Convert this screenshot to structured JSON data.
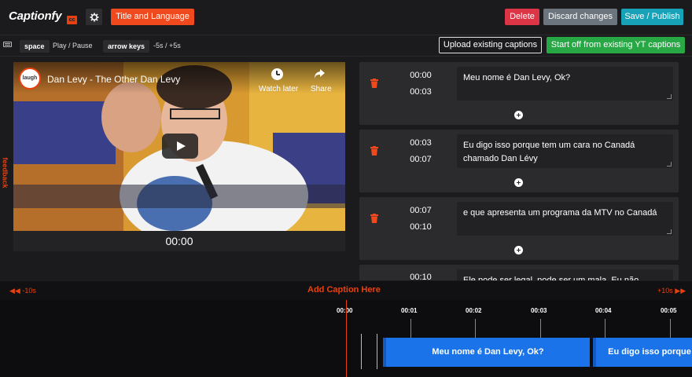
{
  "header": {
    "logo": "Captionfy",
    "logo_badge": "cc",
    "title_language_label": "Title and Language",
    "delete_label": "Delete",
    "discard_label": "Discard changes",
    "save_label": "Save / Publish"
  },
  "subbar": {
    "space_key": "space",
    "space_action": "Play / Pause",
    "arrow_key": "arrow keys",
    "arrow_action": "-5s / +5s",
    "upload_label": "Upload existing captions",
    "yt_label": "Start off from existing YT captions"
  },
  "sidebar": {
    "feedback": "feedback"
  },
  "video": {
    "channel": "laugh",
    "title": "Dan Levy - The Other Dan Levy",
    "watch_later": "Watch later",
    "share": "Share",
    "current_time": "00:00"
  },
  "captions": [
    {
      "start": "00:00",
      "end": "00:03",
      "text": "Meu nome é Dan Levy, Ok?"
    },
    {
      "start": "00:03",
      "end": "00:07",
      "text": "Eu digo isso porque tem um cara no Canadá chamado Dan Lévy"
    },
    {
      "start": "00:07",
      "end": "00:10",
      "text": "e que apresenta um programa da MTV no Canadá"
    },
    {
      "start": "00:10",
      "end": "",
      "text": "Ele pode ser legal, pode ser um mala. Eu não"
    }
  ],
  "timeline": {
    "back_label": "-10s",
    "fwd_label": "+10s",
    "add_caption": "Add Caption Here",
    "ticks": [
      "00:00",
      "00:01",
      "00:02",
      "00:03",
      "00:04",
      "00:05"
    ],
    "blocks": [
      "Meu nome é Dan Levy, Ok?",
      "Eu digo isso porque"
    ]
  },
  "colors": {
    "accent": "#f1491e",
    "delete": "#dc3545",
    "discard": "#6c757d",
    "save": "#17a2b8",
    "yt": "#28a745",
    "caption_block": "#1a73e8"
  }
}
